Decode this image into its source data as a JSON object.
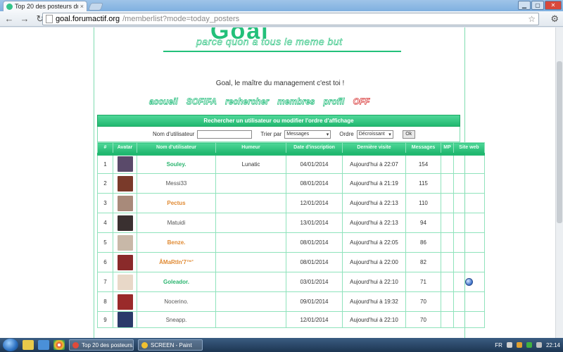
{
  "browser": {
    "tab_title": "Top 20 des posteurs du jo",
    "tab_close": "×",
    "url_domain": "goal.forumactif.org",
    "url_path": "/memberlist?mode=today_posters"
  },
  "site": {
    "slogan": "parce quon a tous le meme but",
    "tagline": "Goal, le maître du management c'est toi !",
    "menu": [
      "accueil",
      "SOFIFA",
      "rechercher",
      "membres",
      "profil",
      "OFF"
    ]
  },
  "search": {
    "header": "Rechercher un utilisateur ou modifier l'ordre d'affichage",
    "username_label": "Nom d'utilisateur",
    "username_value": "",
    "sort_label": "Trier par",
    "sort_value": "Messages",
    "order_label": "Ordre",
    "order_value": "Décroissant",
    "ok_label": "Ok"
  },
  "table": {
    "columns": [
      "#",
      "Avatar",
      "Nom d'utilisateur",
      "Humeur",
      "Date d'inscription",
      "Dernière visite",
      "Messages",
      "MP",
      "Site web"
    ],
    "rows": [
      {
        "rank": "1",
        "name": "Souley.",
        "name_style": "green",
        "mood": "Lunatic",
        "joined": "04/01/2014",
        "last_visit": "Aujourd'hui à 22:07",
        "messages": "154",
        "avatar_color": "#5a4a6a"
      },
      {
        "rank": "2",
        "name": "Messi33",
        "name_style": "plain",
        "mood": "",
        "joined": "08/01/2014",
        "last_visit": "Aujourd'hui à 21:19",
        "messages": "115",
        "avatar_color": "#7a3a2a"
      },
      {
        "rank": "3",
        "name": "Pectus",
        "name_style": "orange",
        "mood": "",
        "joined": "12/01/2014",
        "last_visit": "Aujourd'hui à 22:13",
        "messages": "110",
        "avatar_color": "#a88a7a"
      },
      {
        "rank": "4",
        "name": "Matuidi",
        "name_style": "plain",
        "mood": "",
        "joined": "13/01/2014",
        "last_visit": "Aujourd'hui à 22:13",
        "messages": "94",
        "avatar_color": "#3a3030"
      },
      {
        "rank": "5",
        "name": "Benze.",
        "name_style": "orange",
        "mood": "",
        "joined": "08/01/2014",
        "last_visit": "Aujourd'hui à 22:05",
        "messages": "86",
        "avatar_color": "#c8b8a8"
      },
      {
        "rank": "6",
        "name": "ÂMaRtIn'7™'",
        "name_style": "orange",
        "mood": "",
        "joined": "08/01/2014",
        "last_visit": "Aujourd'hui à 22:00",
        "messages": "82",
        "avatar_color": "#8a2a2a"
      },
      {
        "rank": "7",
        "name": "Goleador.",
        "name_style": "green",
        "mood": "",
        "joined": "03/01/2014",
        "last_visit": "Aujourd'hui à 22:10",
        "messages": "71",
        "avatar_color": "#e8d8c8",
        "has_website": true
      },
      {
        "rank": "8",
        "name": "Nocerino.",
        "name_style": "plain",
        "mood": "",
        "joined": "09/01/2014",
        "last_visit": "Aujourd'hui à 19:32",
        "messages": "70",
        "avatar_color": "#9a2a2a"
      },
      {
        "rank": "9",
        "name": "Sneapp.",
        "name_style": "plain",
        "mood": "",
        "joined": "12/01/2014",
        "last_visit": "Aujourd'hui à 22:10",
        "messages": "70",
        "avatar_color": "#2a3a6a"
      }
    ]
  },
  "taskbar": {
    "tasks": [
      "Top 20 des posteurs...",
      "SCREEN - Paint"
    ],
    "lang": "FR",
    "clock": "22:14"
  },
  "colors": {
    "accent_green": "#23c07a",
    "orange_user": "#e08a33",
    "off_red": "#d83a3a"
  }
}
